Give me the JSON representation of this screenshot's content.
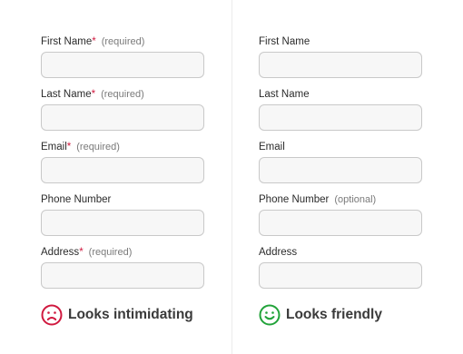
{
  "left": {
    "fields": [
      {
        "label": "First Name",
        "required_mark": "*",
        "hint": "(required)"
      },
      {
        "label": "Last Name",
        "required_mark": "*",
        "hint": "(required)"
      },
      {
        "label": "Email",
        "required_mark": "*",
        "hint": "(required)"
      },
      {
        "label": "Phone Number",
        "required_mark": "",
        "hint": ""
      },
      {
        "label": "Address",
        "required_mark": "*",
        "hint": "(required)"
      }
    ],
    "verdict": "Looks intimidating",
    "verdict_icon": "frown-face-icon",
    "verdict_color": "#d0193f"
  },
  "right": {
    "fields": [
      {
        "label": "First Name",
        "hint": ""
      },
      {
        "label": "Last Name",
        "hint": ""
      },
      {
        "label": "Email",
        "hint": ""
      },
      {
        "label": "Phone Number",
        "hint": "(optional)"
      },
      {
        "label": "Address",
        "hint": ""
      }
    ],
    "verdict": "Looks friendly",
    "verdict_icon": "smile-face-icon",
    "verdict_color": "#22a33a"
  }
}
